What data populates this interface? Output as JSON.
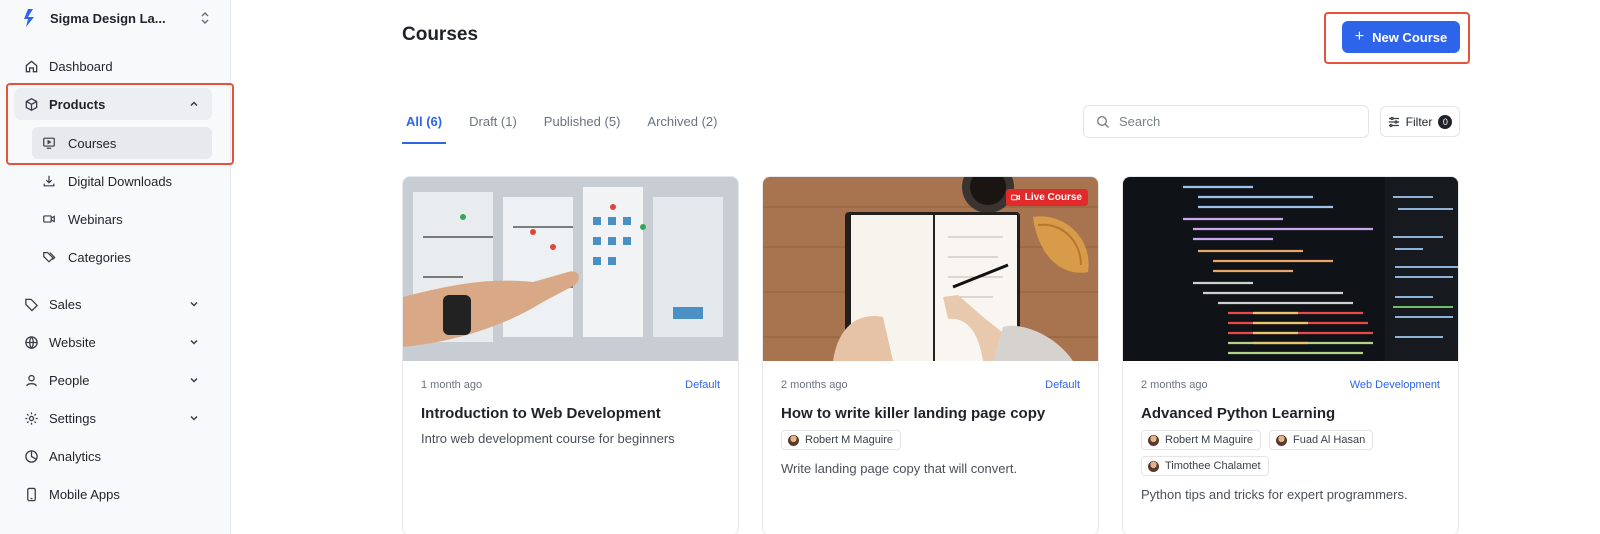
{
  "workspace": {
    "name": "Sigma Design La..."
  },
  "sidebar": {
    "items": [
      {
        "label": "Dashboard"
      },
      {
        "label": "Products"
      },
      {
        "label": "Sales"
      },
      {
        "label": "Website"
      },
      {
        "label": "People"
      },
      {
        "label": "Settings"
      },
      {
        "label": "Analytics"
      },
      {
        "label": "Mobile Apps"
      }
    ],
    "products_sub": [
      {
        "label": "Courses"
      },
      {
        "label": "Digital Downloads"
      },
      {
        "label": "Webinars"
      },
      {
        "label": "Categories"
      }
    ]
  },
  "page": {
    "title": "Courses",
    "new_button": "New Course"
  },
  "tabs": [
    {
      "label": "All (6)"
    },
    {
      "label": "Draft (1)"
    },
    {
      "label": "Published (5)"
    },
    {
      "label": "Archived (2)"
    }
  ],
  "search": {
    "placeholder": "Search"
  },
  "filter": {
    "label": "Filter",
    "count": "0"
  },
  "courses": [
    {
      "time": "1 month ago",
      "category": "Default",
      "title": "Introduction to Web Development",
      "authors": [],
      "description": "Intro web development course for beginners"
    },
    {
      "time": "2 months ago",
      "category": "Default",
      "title": "How to write killer landing page copy",
      "badge": "Live Course",
      "authors": [
        "Robert M Maguire"
      ],
      "description": "Write landing page copy that will convert."
    },
    {
      "time": "2 months ago",
      "category": "Web Development",
      "title": "Advanced Python Learning",
      "authors": [
        "Robert M Maguire",
        "Fuad Al Hasan",
        "Timothee Chalamet"
      ],
      "description": "Python tips and tricks for expert programmers."
    }
  ],
  "colors": {
    "accent": "#2e64e9",
    "highlight": "#e5533a",
    "live": "#e32a2a"
  }
}
